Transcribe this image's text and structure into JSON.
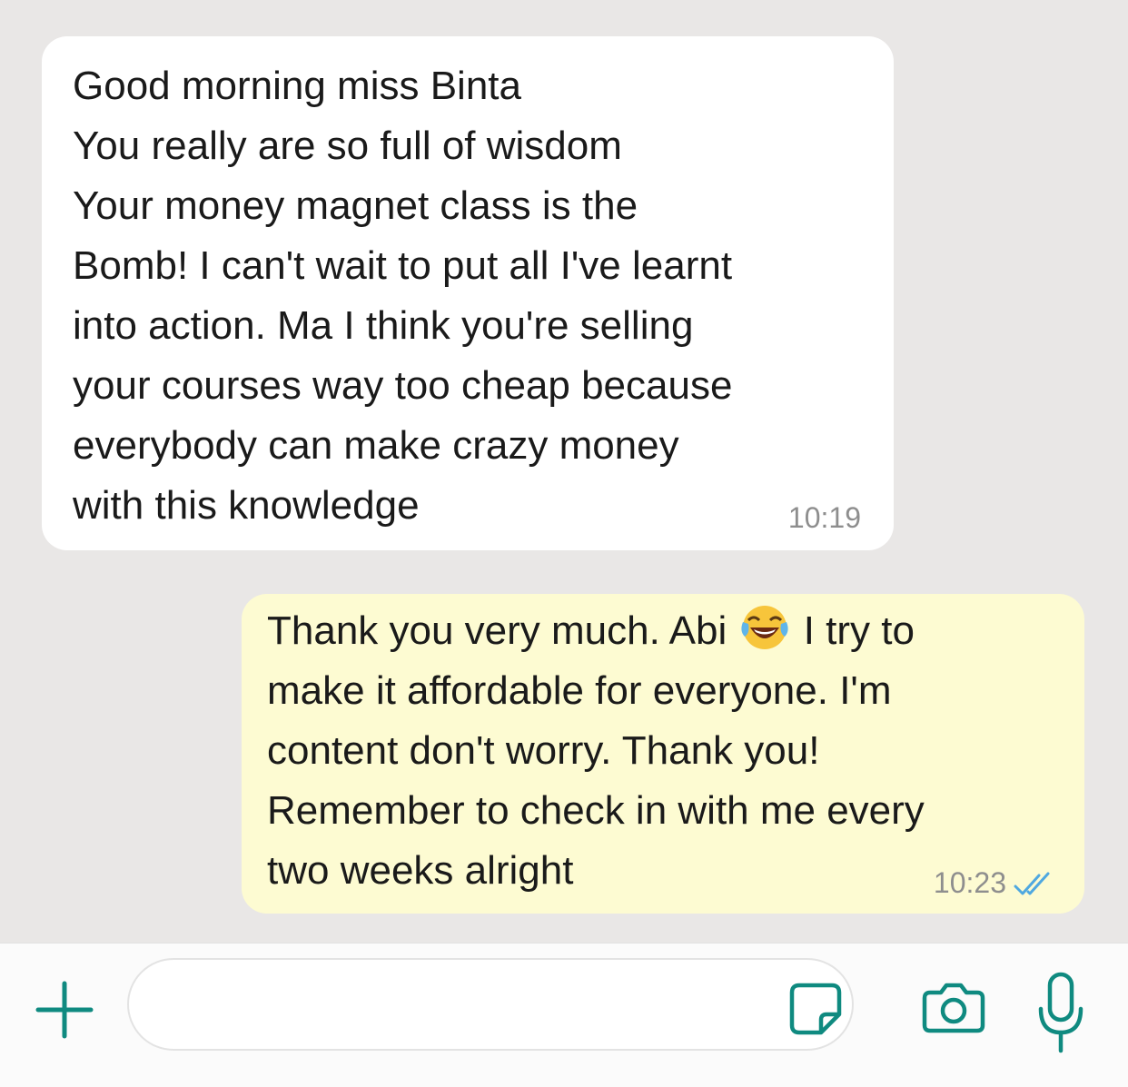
{
  "conversation": {
    "incoming": {
      "lines": [
        "Good morning miss Binta",
        "You really are so full of wisdom",
        "Your money magnet class is the",
        "Bomb! I can't wait to put all I've learnt",
        "into action. Ma I think you're selling",
        "your courses way too cheap because",
        "everybody can make crazy money",
        "with this knowledge"
      ],
      "time": "10:19"
    },
    "outgoing": {
      "line1_before_emoji": "Thank you very much. Abi ",
      "emoji": "laughing-with-tears-emoji",
      "line1_after_emoji": " I try to",
      "lines": [
        "make it affordable for everyone. I'm",
        "content don't worry. Thank you!",
        "Remember to check in with me every",
        "two weeks alright"
      ],
      "time": "10:23",
      "status": "read-double-check"
    }
  },
  "composer": {
    "placeholder": "",
    "icons": {
      "add": "plus-icon",
      "sticker": "sticker-icon",
      "camera": "camera-icon",
      "microphone": "microphone-icon"
    }
  },
  "colors": {
    "chat_background": "#e9e7e6",
    "incoming_bubble": "#ffffff",
    "outgoing_bubble": "#fdfbd2",
    "accent": "#0f8a80",
    "read_ticks": "#4fa8e0",
    "timestamp": "#8e8e8e"
  }
}
